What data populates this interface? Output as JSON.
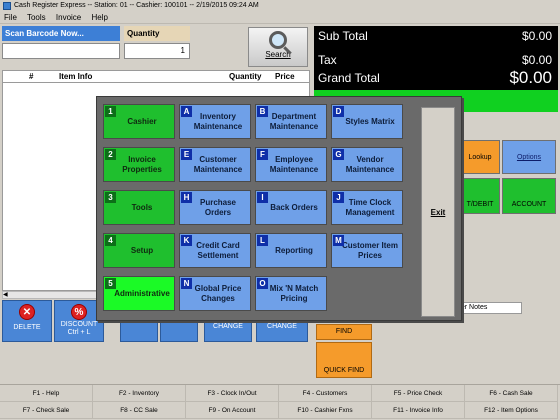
{
  "window": {
    "title": "Cash Register Express -- Station: 01 -- Cashier: 100101 -- 2/19/2015 09:24 AM"
  },
  "menu": {
    "file": "File",
    "tools": "Tools",
    "invoice": "Invoice",
    "help": "Help"
  },
  "scan": {
    "label": "Scan Barcode Now...",
    "value": ""
  },
  "quantity": {
    "label": "Quantity",
    "value": "1"
  },
  "search": {
    "label": "Search"
  },
  "grid": {
    "col_hash": "#",
    "col_item": "Item Info",
    "col_qty": "Quantity",
    "col_price": "Price",
    "scroll_left": "◀"
  },
  "totals": {
    "subtotal_label": "Sub Total",
    "subtotal_value": "$0.00",
    "tax_label": "Tax",
    "tax_value": "$0.00",
    "grand_label": "Grand Total",
    "grand_value": "$0.00"
  },
  "right": {
    "lookup": "Lookup",
    "options": "Options",
    "debit": "T/DEBIT",
    "account": "ACCOUNT",
    "customer_notes": "ner Notes"
  },
  "actions": {
    "delete": "DELETE",
    "discount_line1": "DISCOUNT",
    "discount_line2": "Ctrl + L",
    "change1": "CHANGE",
    "change2": "CHANGE",
    "find": "FIND",
    "quick_find": "QUICK FIND"
  },
  "modal": {
    "exit": "Exit",
    "buttons": [
      {
        "key": "1",
        "label": "Cashier",
        "style": "green"
      },
      {
        "key": "A",
        "label": "Inventory Maintenance",
        "style": "blue"
      },
      {
        "key": "B",
        "label": "Department Maintenance",
        "style": "blue"
      },
      {
        "key": "D",
        "label": "Styles Matrix",
        "style": "blue"
      },
      {
        "key": "2",
        "label": "Invoice Properties",
        "style": "green"
      },
      {
        "key": "E",
        "label": "Customer Maintenance",
        "style": "blue"
      },
      {
        "key": "F",
        "label": "Employee Maintenance",
        "style": "blue"
      },
      {
        "key": "G",
        "label": "Vendor Maintenance",
        "style": "blue"
      },
      {
        "key": "3",
        "label": "Tools",
        "style": "green"
      },
      {
        "key": "H",
        "label": "Purchase Orders",
        "style": "blue"
      },
      {
        "key": "I",
        "label": "Back Orders",
        "style": "blue"
      },
      {
        "key": "J",
        "label": "Time Clock Management",
        "style": "blue"
      },
      {
        "key": "4",
        "label": "Setup",
        "style": "green"
      },
      {
        "key": "K",
        "label": "Credit Card Settlement",
        "style": "blue"
      },
      {
        "key": "L",
        "label": "Reporting",
        "style": "blue"
      },
      {
        "key": "M",
        "label": "Customer Item Prices",
        "style": "blue"
      },
      {
        "key": "5",
        "label": "Administrative",
        "style": "lime"
      },
      {
        "key": "N",
        "label": "Global Price Changes",
        "style": "blue"
      },
      {
        "key": "O",
        "label": "Mix 'N Match Pricing",
        "style": "blue"
      }
    ]
  },
  "fkeys": [
    "F1 - Help",
    "F2 - Inventory",
    "F3 - Clock In/Out",
    "F4 - Customers",
    "F5 - Price Check",
    "F6 - Cash Sale",
    "F7 - Check Sale",
    "F8 - CC Sale",
    "F9 - On Account",
    "F10 - Cashier Fxns",
    "F11 - Invoice Info",
    "F12 - Item Options"
  ],
  "colors": {
    "accent_blue": "#3d7fd6",
    "total_green": "#10d020",
    "modal_green": "#1fbf2e",
    "modal_blue": "#6fa0e8"
  }
}
